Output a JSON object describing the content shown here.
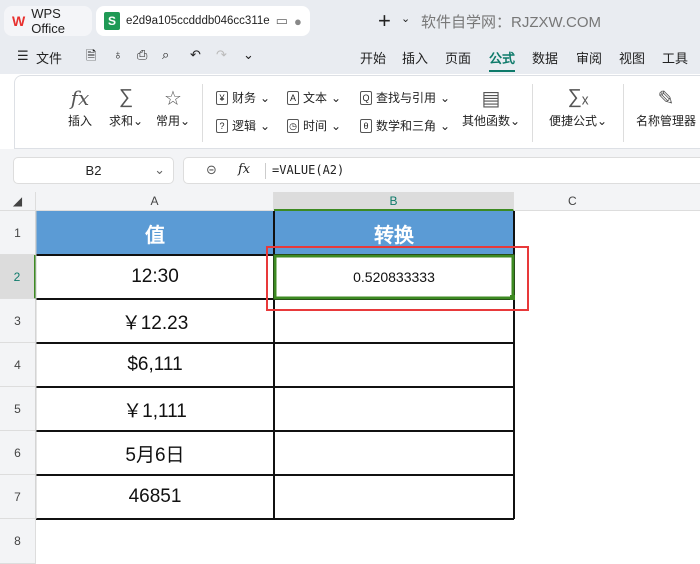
{
  "tabs": [
    {
      "label": "WPS Office"
    },
    {
      "label": "e2d9a105ccdddb046cc311e"
    }
  ],
  "watermark": "软件自学网：RJZXW.COM",
  "menu": {
    "file": "文件",
    "items": [
      "开始",
      "插入",
      "页面",
      "公式",
      "数据",
      "审阅",
      "视图",
      "工具"
    ],
    "active": "公式"
  },
  "ribbon": {
    "insert": "插入",
    "sum": "求和",
    "common": "常用",
    "finance": "财务",
    "logic": "逻辑",
    "text": "文本",
    "time": "时间",
    "lookup": "查找与引用",
    "math": "数学和三角",
    "other": "其他函数",
    "quick": "便捷公式",
    "names": "名称管理器"
  },
  "namebox": "B2",
  "formula": "=VALUE(A2)",
  "columns": [
    "A",
    "B",
    "C"
  ],
  "rows": [
    "1",
    "2",
    "3",
    "4",
    "5",
    "6",
    "7",
    "8"
  ],
  "header": {
    "a": "值",
    "b": "转换"
  },
  "values": [
    "12:30",
    "￥12.23",
    "$6,111",
    "￥1,111",
    "5月6日",
    "46851"
  ],
  "b2": "0.520833333"
}
